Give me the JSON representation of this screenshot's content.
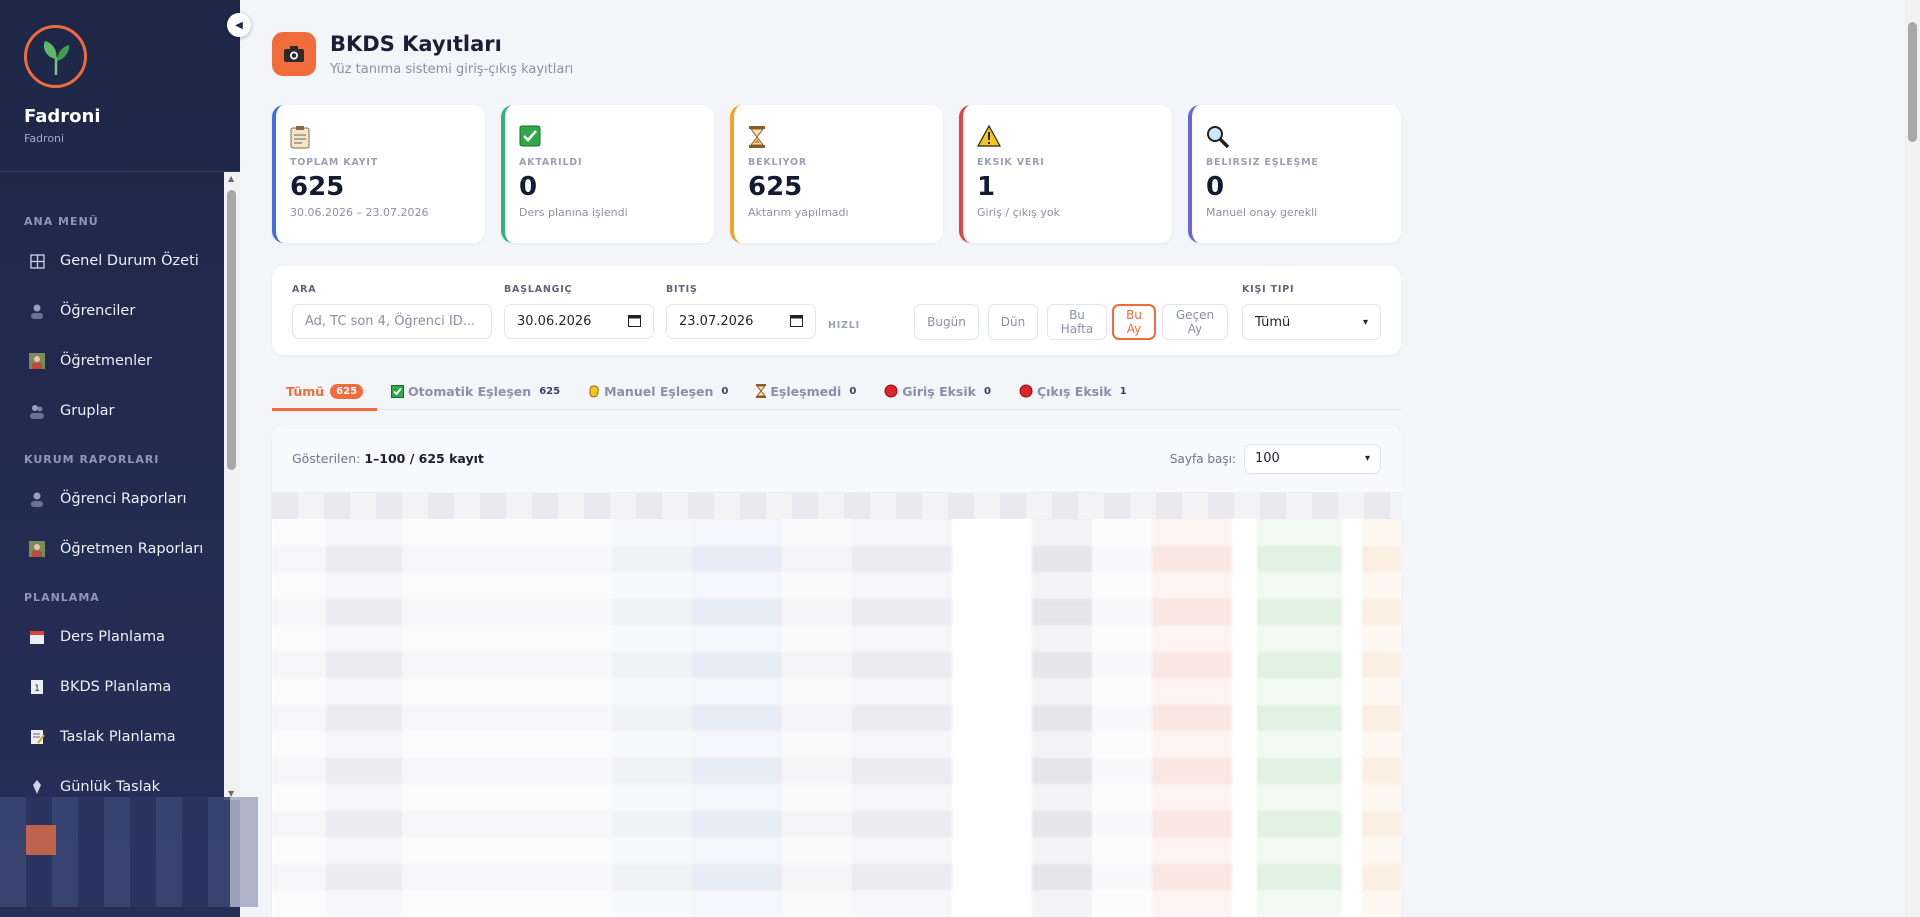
{
  "brand": {
    "name": "Fadroni",
    "subtitle": "Fadroni"
  },
  "sidebar": {
    "sections": [
      {
        "title": "ANA MENÜ",
        "items": [
          {
            "label": "Genel Durum Özeti",
            "icon": "grid-icon"
          },
          {
            "label": "Öğrenciler",
            "icon": "student-icon"
          },
          {
            "label": "Öğretmenler",
            "icon": "teacher-icon"
          },
          {
            "label": "Gruplar",
            "icon": "group-icon"
          }
        ]
      },
      {
        "title": "KURUM RAPORLARI",
        "items": [
          {
            "label": "Öğrenci Raporları",
            "icon": "student-icon"
          },
          {
            "label": "Öğretmen Raporları",
            "icon": "teacher-icon"
          }
        ]
      },
      {
        "title": "PLANLAMA",
        "items": [
          {
            "label": "Ders Planlama",
            "icon": "calendar-icon"
          },
          {
            "label": "BKDS Planlama",
            "icon": "calendar-one-icon"
          },
          {
            "label": "Taslak Planlama",
            "icon": "memo-icon"
          },
          {
            "label": "Günlük Taslak",
            "icon": "pin-icon"
          }
        ]
      }
    ]
  },
  "header": {
    "title": "BKDS Kayıtları",
    "subtitle": "Yüz tanıma sistemi giriş-çıkış kayıtları",
    "icon": "camera-icon"
  },
  "stats": [
    {
      "label": "TOPLAM KAYIT",
      "value": "625",
      "sub": "30.06.2026 – 23.07.2026",
      "color": "#3f6fe0",
      "icon": "clipboard-icon"
    },
    {
      "label": "AKTARILDI",
      "value": "0",
      "sub": "Ders planına işlendi",
      "color": "#2fb67c",
      "icon": "check-box-icon"
    },
    {
      "label": "BEKLIYOR",
      "value": "625",
      "sub": "Aktarım yapılmadı",
      "color": "#f0a52a",
      "icon": "hourglass-icon"
    },
    {
      "label": "EKSIK VERI",
      "value": "1",
      "sub": "Giriş / çıkış yok",
      "color": "#e04646",
      "icon": "warning-icon"
    },
    {
      "label": "BELIRSIZ EŞLEŞME",
      "value": "0",
      "sub": "Manuel onay gerekli",
      "color": "#6c63e0",
      "icon": "magnifier-icon"
    }
  ],
  "filters": {
    "search": {
      "label": "ARA",
      "placeholder": "Ad, TC son 4, Öğrenci ID..."
    },
    "start": {
      "label": "BAŞLANGIÇ",
      "value": "30.06.2026"
    },
    "end": {
      "label": "BITIŞ",
      "value": "23.07.2026"
    },
    "quick_label": "HIZLI",
    "quick": [
      {
        "line1": "Bugün",
        "line2": ""
      },
      {
        "line1": "Dün",
        "line2": ""
      },
      {
        "line1": "Bu",
        "line2": "Hafta"
      },
      {
        "line1": "Bu",
        "line2": "Ay"
      },
      {
        "line1": "Geçen",
        "line2": "Ay"
      }
    ],
    "quick_active": "Bu Ay",
    "person_type": {
      "label": "KIŞI TIPI",
      "value": "Tümü"
    }
  },
  "tabs": [
    {
      "label": "Tümü",
      "count": "625"
    },
    {
      "label": "Otomatik Eşleşen",
      "count": "625",
      "icon": "check-box-icon"
    },
    {
      "label": "Manuel Eşleşen",
      "count": "0",
      "icon": "hand-icon"
    },
    {
      "label": "Eşleşmedi",
      "count": "0",
      "icon": "hourglass-icon"
    },
    {
      "label": "Giriş Eksik",
      "count": "0",
      "icon": "red-dot-icon"
    },
    {
      "label": "Çıkış Eksik",
      "count": "1",
      "icon": "red-dot-icon"
    }
  ],
  "table": {
    "shown_prefix": "Gösterilen:",
    "shown_value": "1–100 / 625 kayıt",
    "per_page_label": "Sayfa başı:",
    "per_page_value": "100"
  },
  "colors": {
    "accent": "#f26b3a",
    "sidebar": "#1e2747"
  }
}
